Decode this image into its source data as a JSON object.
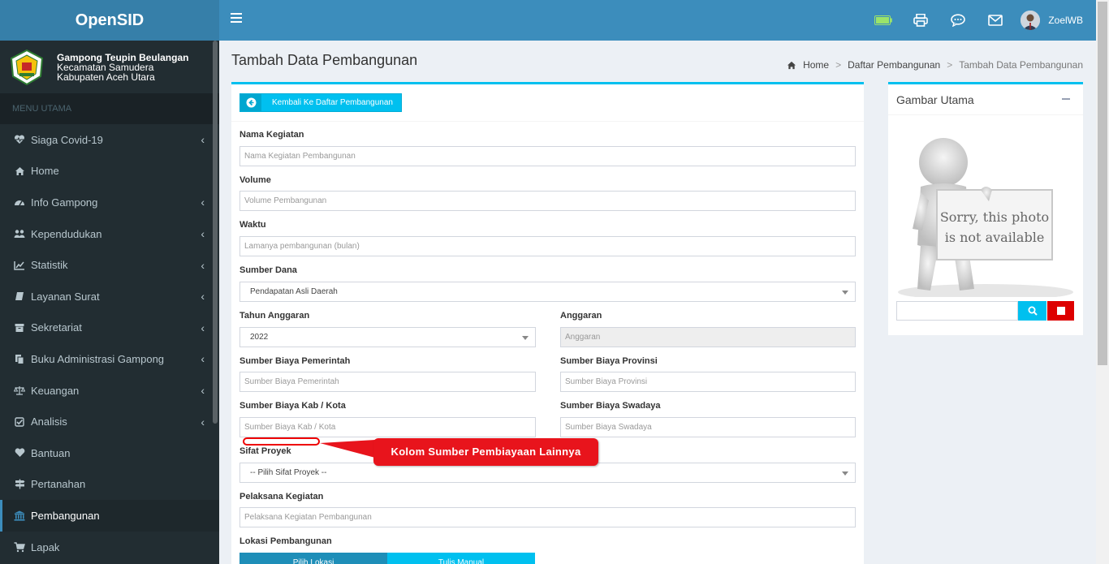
{
  "app": {
    "brand": "OpenSID"
  },
  "village": {
    "name": "Gampong Teupin Beulangan",
    "district": "Kecamatan Samudera",
    "regency": "Kabupaten Aceh Utara"
  },
  "sidebar": {
    "header": "MENU UTAMA",
    "items": [
      {
        "label": "Siaga Covid-19",
        "icon": "heartbeat-icon"
      },
      {
        "label": "Home",
        "icon": "home-icon"
      },
      {
        "label": "Info Gampong",
        "icon": "dashboard-icon"
      },
      {
        "label": "Kependudukan",
        "icon": "users-icon"
      },
      {
        "label": "Statistik",
        "icon": "line-chart-icon"
      },
      {
        "label": "Layanan Surat",
        "icon": "book-icon"
      },
      {
        "label": "Sekretariat",
        "icon": "archive-icon"
      },
      {
        "label": "Buku Administrasi Gampong",
        "icon": "copy-icon"
      },
      {
        "label": "Keuangan",
        "icon": "balance-scale-icon"
      },
      {
        "label": "Analisis",
        "icon": "check-square-icon"
      },
      {
        "label": "Bantuan",
        "icon": "heart-icon"
      },
      {
        "label": "Pertanahan",
        "icon": "map-signs-icon"
      },
      {
        "label": "Pembangunan",
        "icon": "institution-icon"
      },
      {
        "label": "Lapak",
        "icon": "cart-icon"
      }
    ]
  },
  "topbar": {
    "username": "ZoelWB"
  },
  "page": {
    "title": "Tambah Data Pembangunan",
    "breadcrumb": [
      "Home",
      "Daftar Pembangunan",
      "Tambah Data Pembangunan"
    ]
  },
  "form": {
    "back_button": "Kembali Ke Daftar Pembangunan",
    "nama_label": "Nama Kegiatan",
    "nama_placeholder": "Nama Kegiatan Pembangunan",
    "volume_label": "Volume",
    "volume_placeholder": "Volume Pembangunan",
    "waktu_label": "Waktu",
    "waktu_placeholder": "Lamanya pembangunan (bulan)",
    "sumber_dana_label": "Sumber Dana",
    "sumber_dana_value": "Pendapatan Asli Daerah",
    "tahun_label": "Tahun Anggaran",
    "tahun_value": "2022",
    "anggaran_label": "Anggaran",
    "anggaran_placeholder": "Anggaran",
    "pemerintah_label": "Sumber Biaya Pemerintah",
    "pemerintah_placeholder": "Sumber Biaya Pemerintah",
    "provinsi_label": "Sumber Biaya Provinsi",
    "provinsi_placeholder": "Sumber Biaya Provinsi",
    "kabkota_label": "Sumber Biaya Kab / Kota",
    "kabkota_placeholder": "Sumber Biaya Kab / Kota",
    "swadaya_label": "Sumber Biaya Swadaya",
    "swadaya_placeholder": "Sumber Biaya Swadaya",
    "sifat_label": "Sifat Proyek",
    "sifat_value": "-- Pilih Sifat Proyek --",
    "pelaksana_label": "Pelaksana Kegiatan",
    "pelaksana_placeholder": "Pelaksana Kegiatan Pembangunan",
    "lokasi_label": "Lokasi Pembangunan",
    "tab_pilih": "Pilih Lokasi",
    "tab_tulis": "Tulis Manual"
  },
  "annotation": {
    "callout_text": "Kolom Sumber Pembiayaan Lainnya"
  },
  "side": {
    "title": "Gambar Utama",
    "photo_line1": "Sorry, this photo",
    "photo_line2": "is not available"
  },
  "colors": {
    "topbar": "#3c8dbc",
    "sidebar": "#222d32",
    "accent": "#00c0ef",
    "danger": "#dd0000",
    "callout": "#e8141c"
  }
}
